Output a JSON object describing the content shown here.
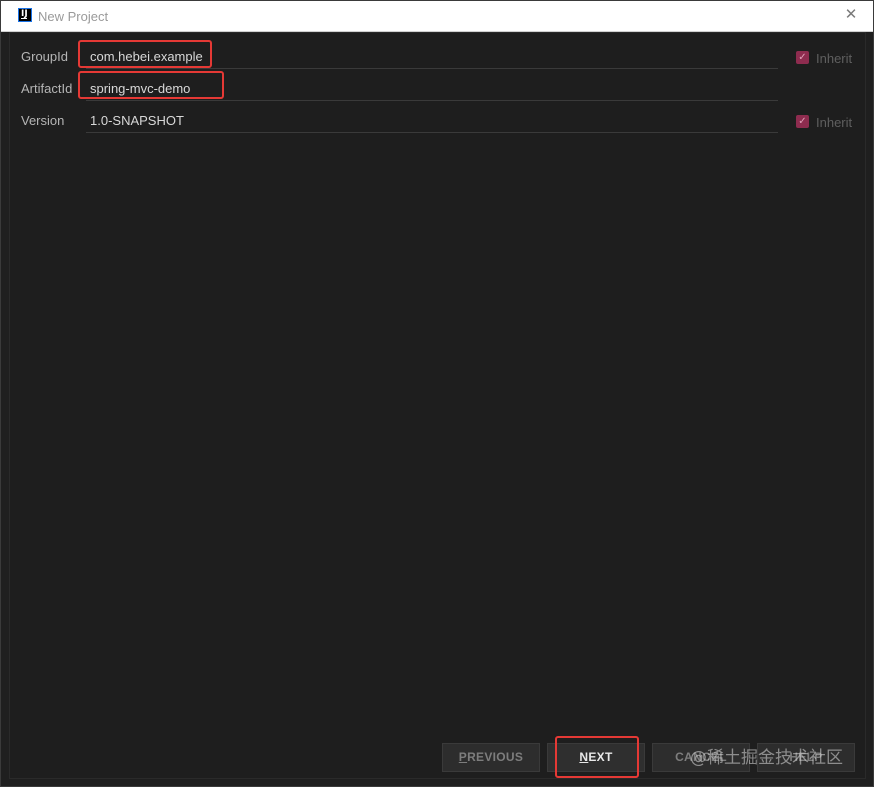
{
  "window": {
    "title": "New Project",
    "close_icon": "close-icon"
  },
  "form": {
    "group_id": {
      "label": "GroupId",
      "value": "com.hebei.example",
      "inherit_label": "Inherit",
      "inherit_checked": true
    },
    "artifact_id": {
      "label": "ArtifactId",
      "value": "spring-mvc-demo"
    },
    "version": {
      "label": "Version",
      "value": "1.0-SNAPSHOT",
      "inherit_label": "Inherit",
      "inherit_checked": true
    }
  },
  "buttons": {
    "previous": {
      "mnemonic": "P",
      "rest": "REVIOUS"
    },
    "next": {
      "mnemonic": "N",
      "rest": "EXT"
    },
    "cancel": "CANCEL",
    "help": "HELP"
  },
  "watermark": "@稀土掘金技术社区",
  "colors": {
    "highlight": "#e53935",
    "checkbox": "#8e2c4f",
    "background": "#1e1e1e"
  }
}
